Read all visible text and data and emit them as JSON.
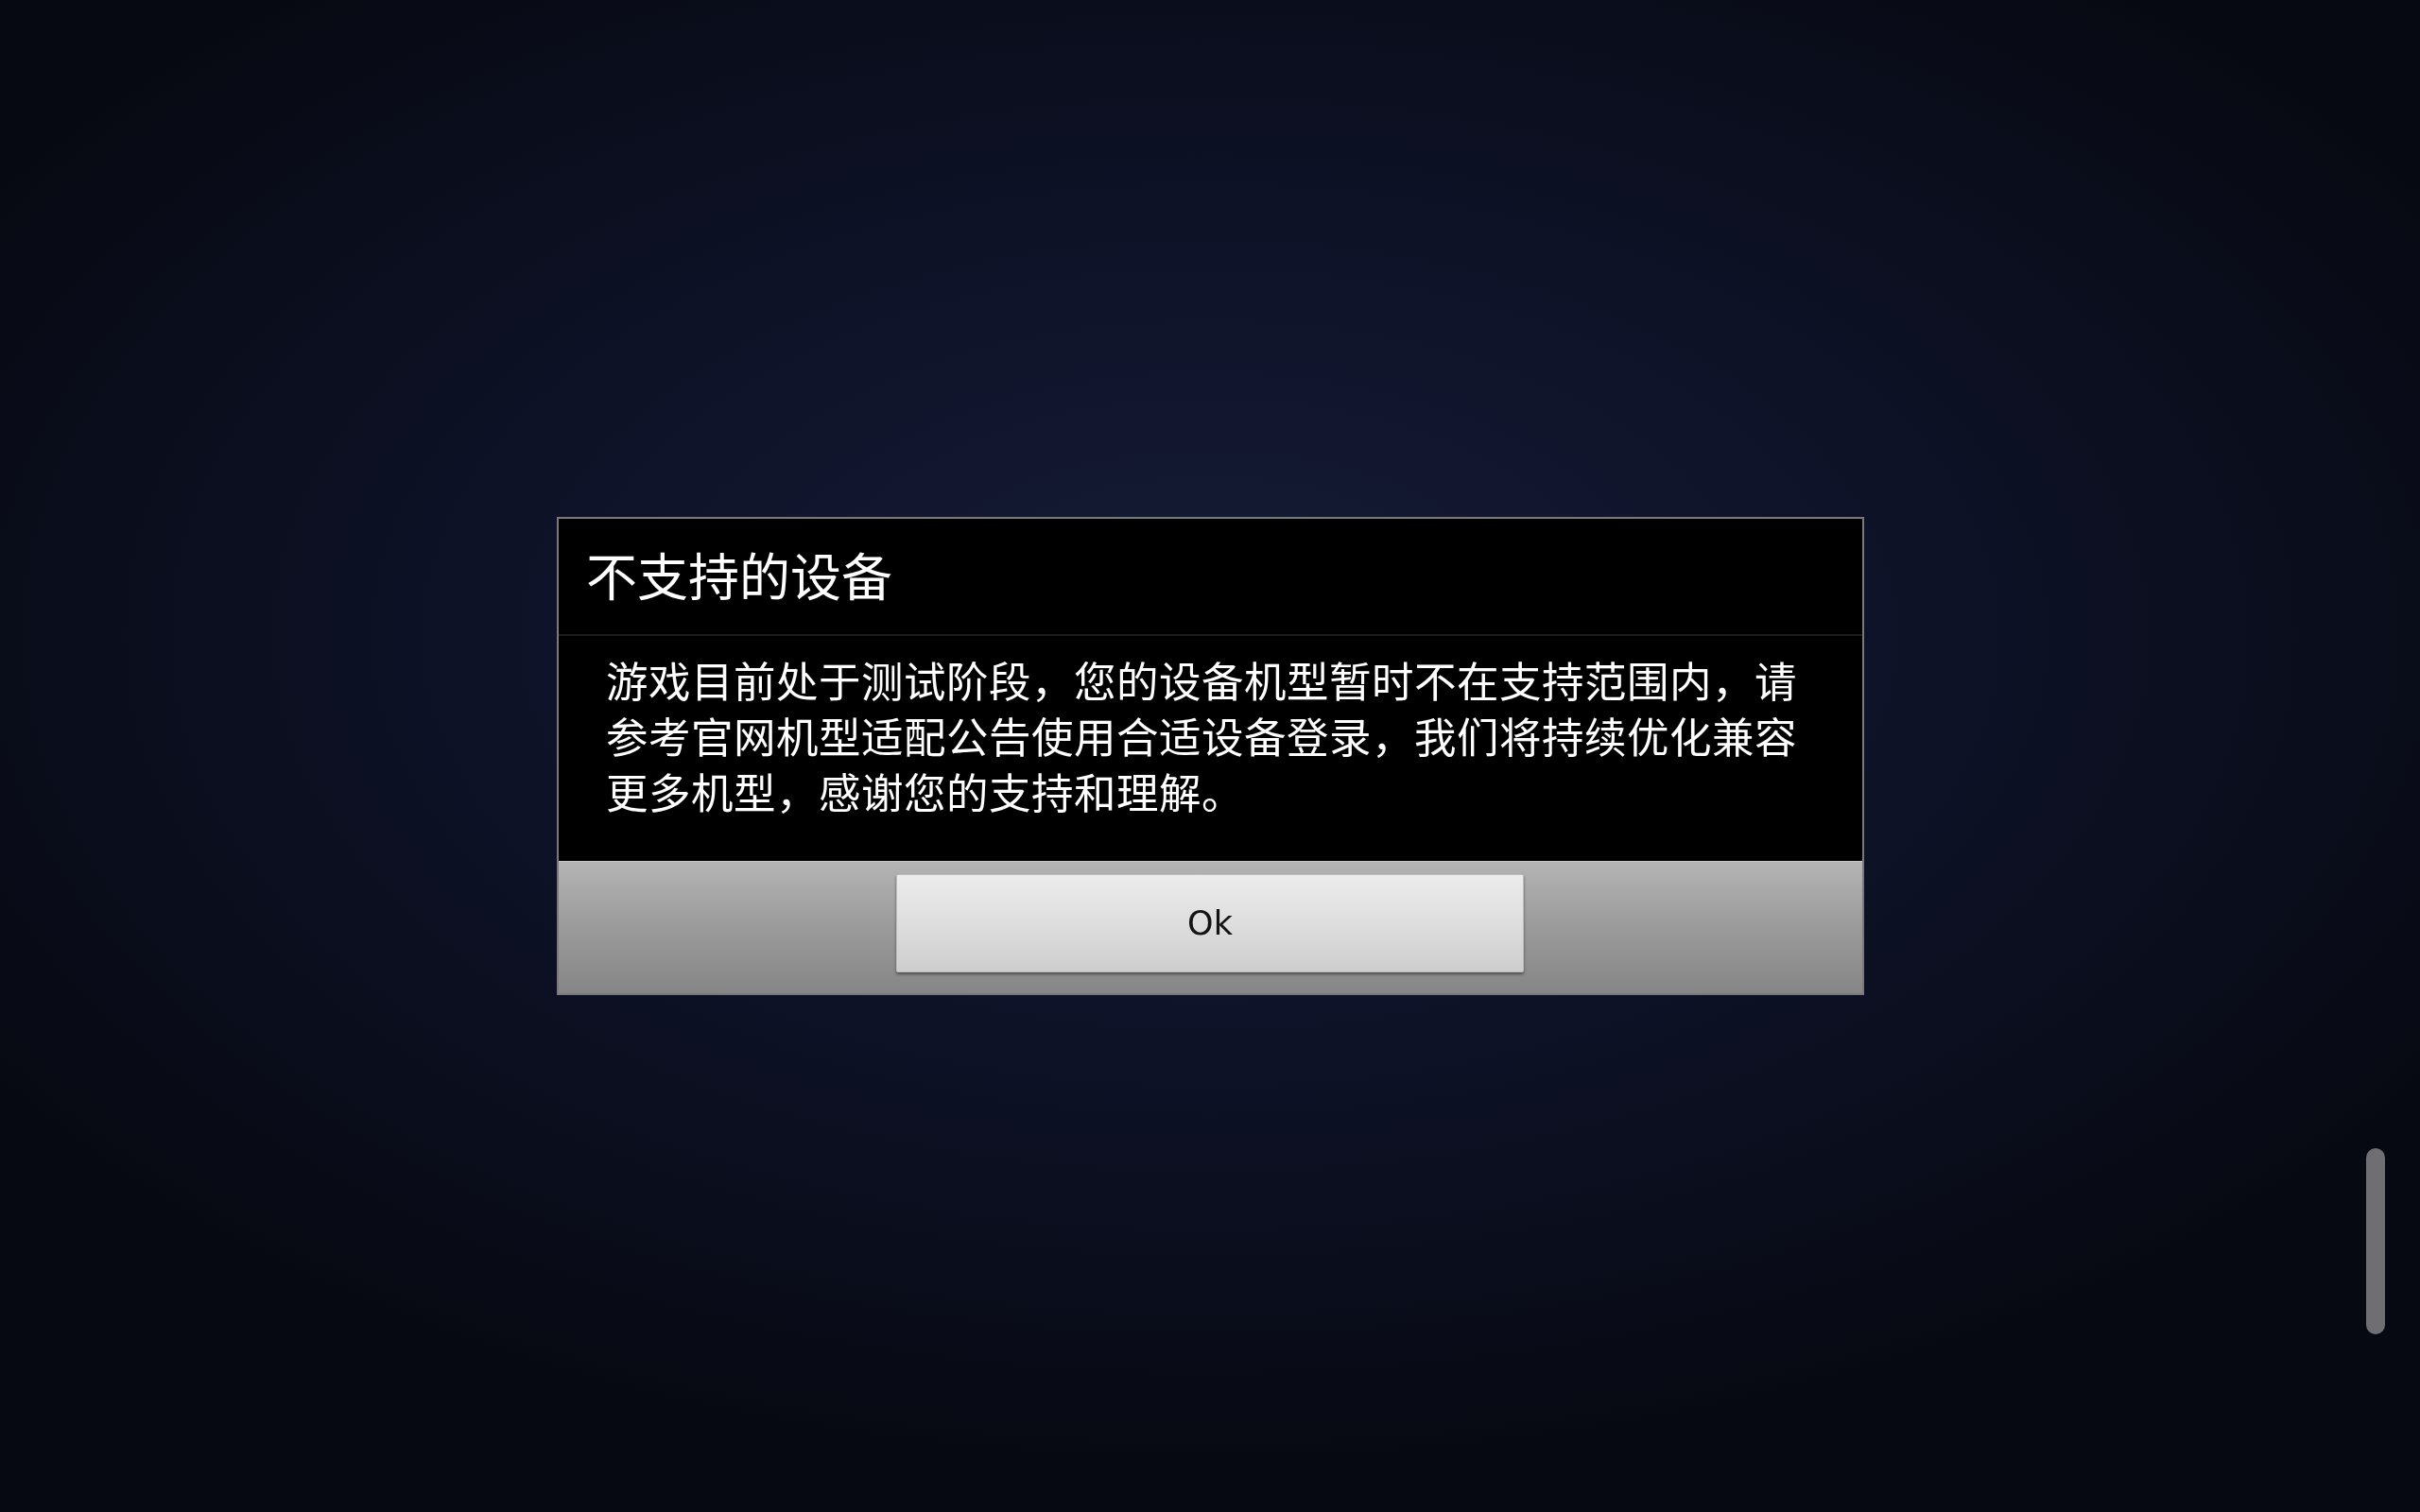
{
  "dialog": {
    "title": "不支持的设备",
    "message": "游戏目前处于测试阶段，您的设备机型暂时不在支持范围内，请参考官网机型适配公告使用合适设备登录，我们将持续优化兼容更多机型，感谢您的支持和理解。",
    "buttons": [
      "Ok"
    ]
  }
}
